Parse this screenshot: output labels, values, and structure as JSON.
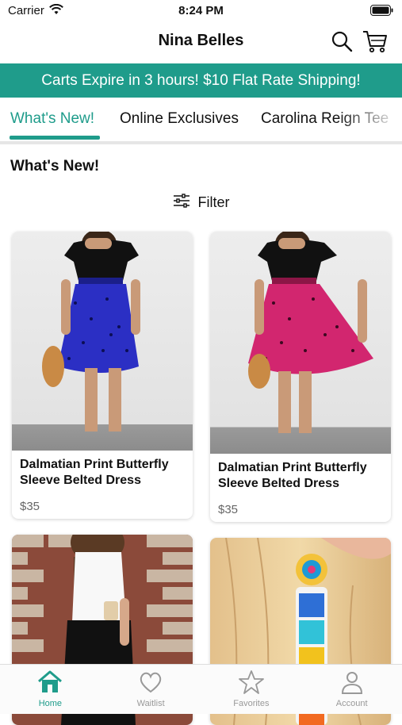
{
  "status_bar": {
    "carrier": "Carrier",
    "time": "8:24 PM"
  },
  "header": {
    "title": "Nina Belles"
  },
  "banner": {
    "text": "Carts Expire in 3 hours! $10 Flat Rate Shipping!"
  },
  "tabs": [
    {
      "label": "What's New!",
      "active": true
    },
    {
      "label": "Online Exclusives",
      "active": false
    },
    {
      "label": "Carolina Reign Tee",
      "active": false
    }
  ],
  "section": {
    "title": "What's New!",
    "filter_label": "Filter"
  },
  "products": [
    {
      "name": "Dalmatian Print Butterfly Sleeve Belted Dress",
      "price": "$35",
      "skirt_color": "#2b2fc4"
    },
    {
      "name": "Dalmatian Print Butterfly Sleeve Belted Dress",
      "price": "$35",
      "skirt_color": "#d2266f"
    },
    {
      "name": "",
      "price": ""
    },
    {
      "name": "",
      "price": ""
    }
  ],
  "tabbar": [
    {
      "label": "Home",
      "icon": "home-icon",
      "active": true
    },
    {
      "label": "Waitlist",
      "icon": "heart-icon",
      "active": false
    },
    {
      "label": "Favorites",
      "icon": "star-icon",
      "active": false
    },
    {
      "label": "Account",
      "icon": "person-icon",
      "active": false
    }
  ],
  "colors": {
    "accent": "#1f9c8b"
  }
}
